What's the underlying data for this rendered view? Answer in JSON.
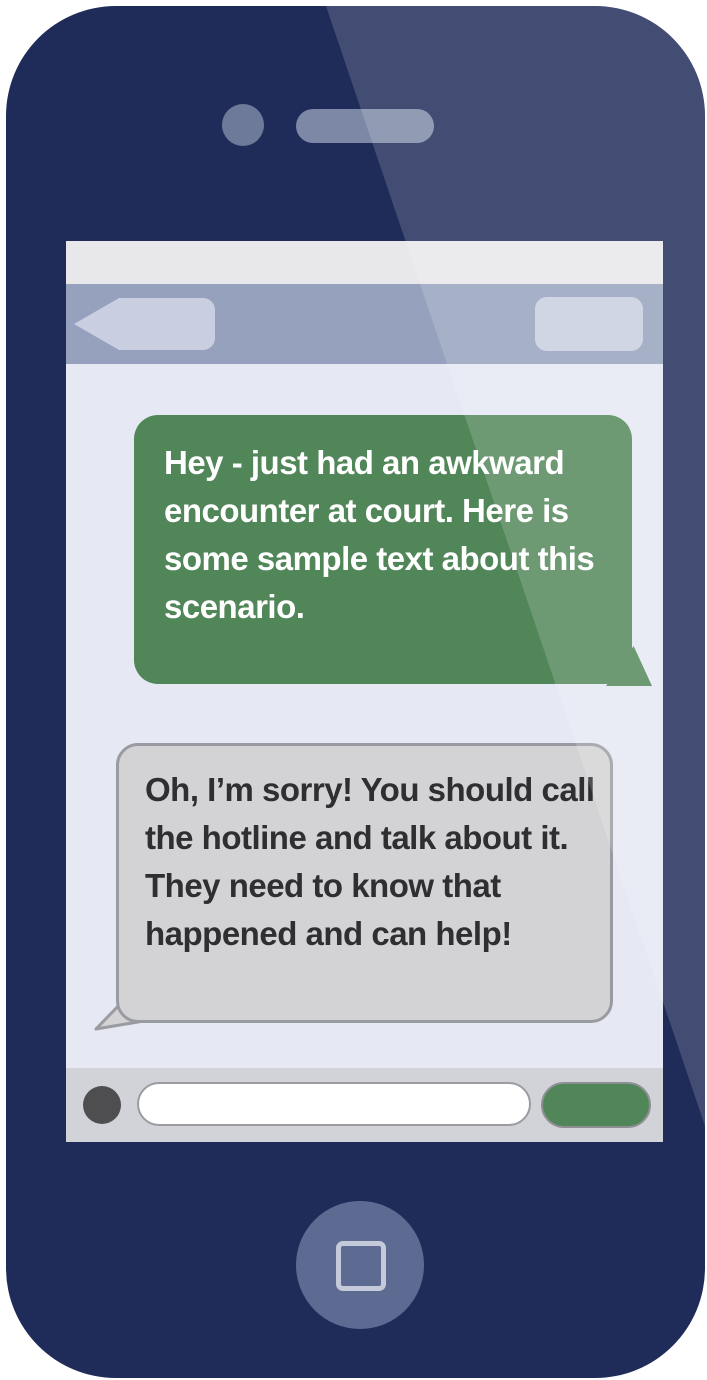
{
  "conversation": {
    "sent_message": "Hey - just had an awkward encounter at court. Here is some sample text  about this scenario.",
    "received_message": "Oh, I’m sorry! You should call the hotline and talk about it. They need to know that happened and can help!"
  },
  "colors": {
    "phone_body": "#1f2c5a",
    "sent_bubble": "#518659",
    "received_bubble": "#d3d3d5",
    "nav_bar": "#96a1bd",
    "screen_background": "#e6e9f4"
  },
  "icons": {
    "back": "back-arrow-icon",
    "camera": "camera-dot-icon",
    "home": "home-square-icon"
  }
}
